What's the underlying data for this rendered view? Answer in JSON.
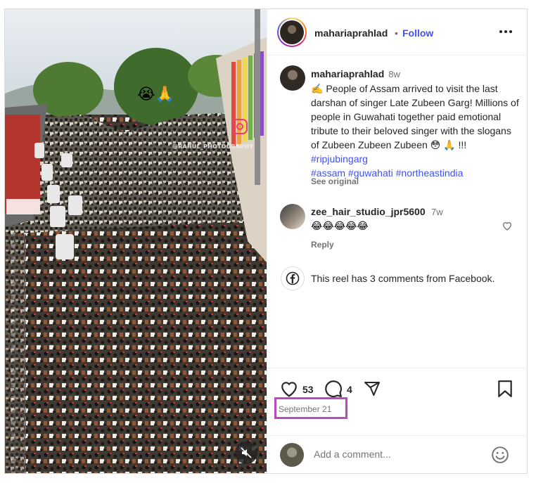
{
  "header": {
    "username": "mahariaprahlad",
    "separator": "•",
    "follow_label": "Follow",
    "more_icon": "more-horizontal-icon"
  },
  "caption": {
    "username": "mahariaprahlad",
    "time": "8w",
    "line1": "✍️ People of Assam arrived to visit the last darshan of singer Late Zubeen Garg! Millions of people in Guwahati together paid emotional tribute to their beloved singer with the slogans of Zubeen Zubeen Zubeen 😳 🙏 !!! ",
    "tag1": "#ripjubingarg",
    "tag2": "#assam",
    "tag3": "#guwahati",
    "tag4": "#northeastindia",
    "see_original": "See original"
  },
  "comment": {
    "username": "zee_hair_studio_jpr5600",
    "time": "7w",
    "text": "😂😂😂😂😂",
    "reply_label": "Reply"
  },
  "facebook_notice": {
    "text": "This reel has 3 comments from Facebook.",
    "icon": "facebook-icon"
  },
  "actions": {
    "likes": "53",
    "comments": "4",
    "date": "September 21"
  },
  "comment_input": {
    "placeholder": "Add a comment..."
  },
  "media": {
    "watermark": "@RAHUL_PHOTOGRAPHY",
    "emoji": "😭🙏"
  },
  "colors": {
    "link": "#4150f7",
    "date_highlight": "#b94ac0",
    "muted": "#737373"
  }
}
